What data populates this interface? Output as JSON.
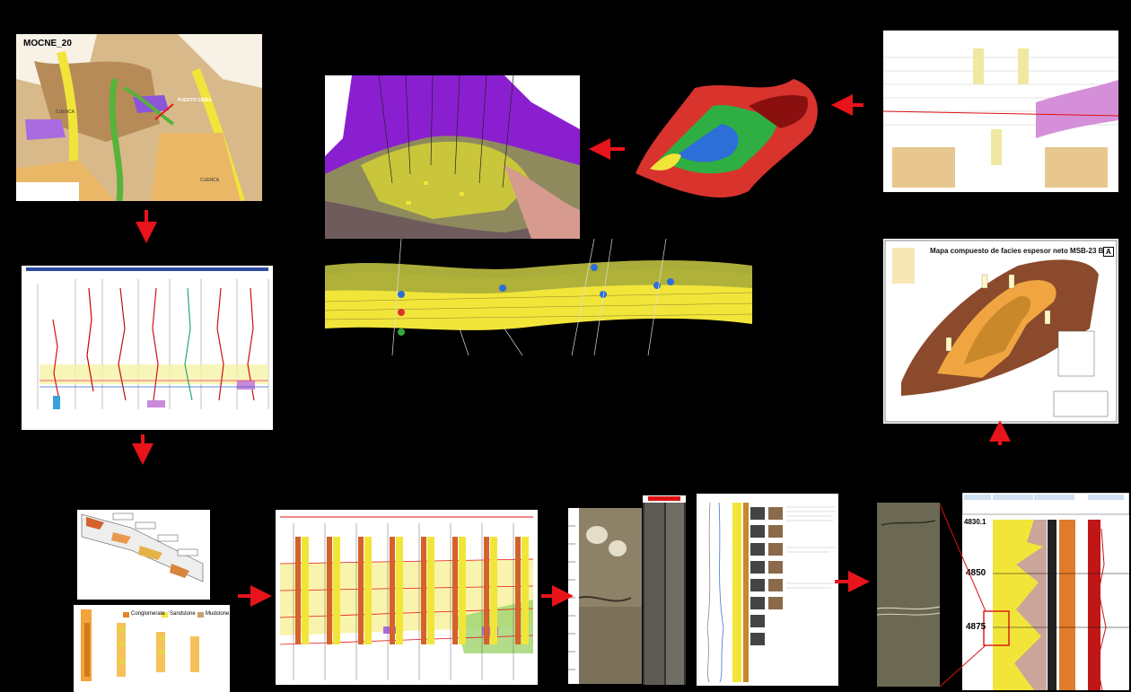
{
  "map_panel": {
    "title": "MOCNE_20",
    "label_a": "CUENCA",
    "label_b": "PUERTO CEIBA",
    "label_c": "CUENCA"
  },
  "thickness_map": {
    "title": "Mapa compuesto de facies espesor neto MSB-23 B",
    "corner": "A"
  },
  "sequence_panel": {
    "legend": [
      "Conglomerate",
      "Sandstone",
      "Mudstone"
    ]
  },
  "core_log": {
    "depths": [
      "4830.1",
      "4850",
      "4875"
    ]
  },
  "colors": {
    "arrow": "#e8141b",
    "yellow": "#f2e53a",
    "brown": "#8b4a2b",
    "purple": "#9b2fd6",
    "green": "#6fbf3a"
  }
}
